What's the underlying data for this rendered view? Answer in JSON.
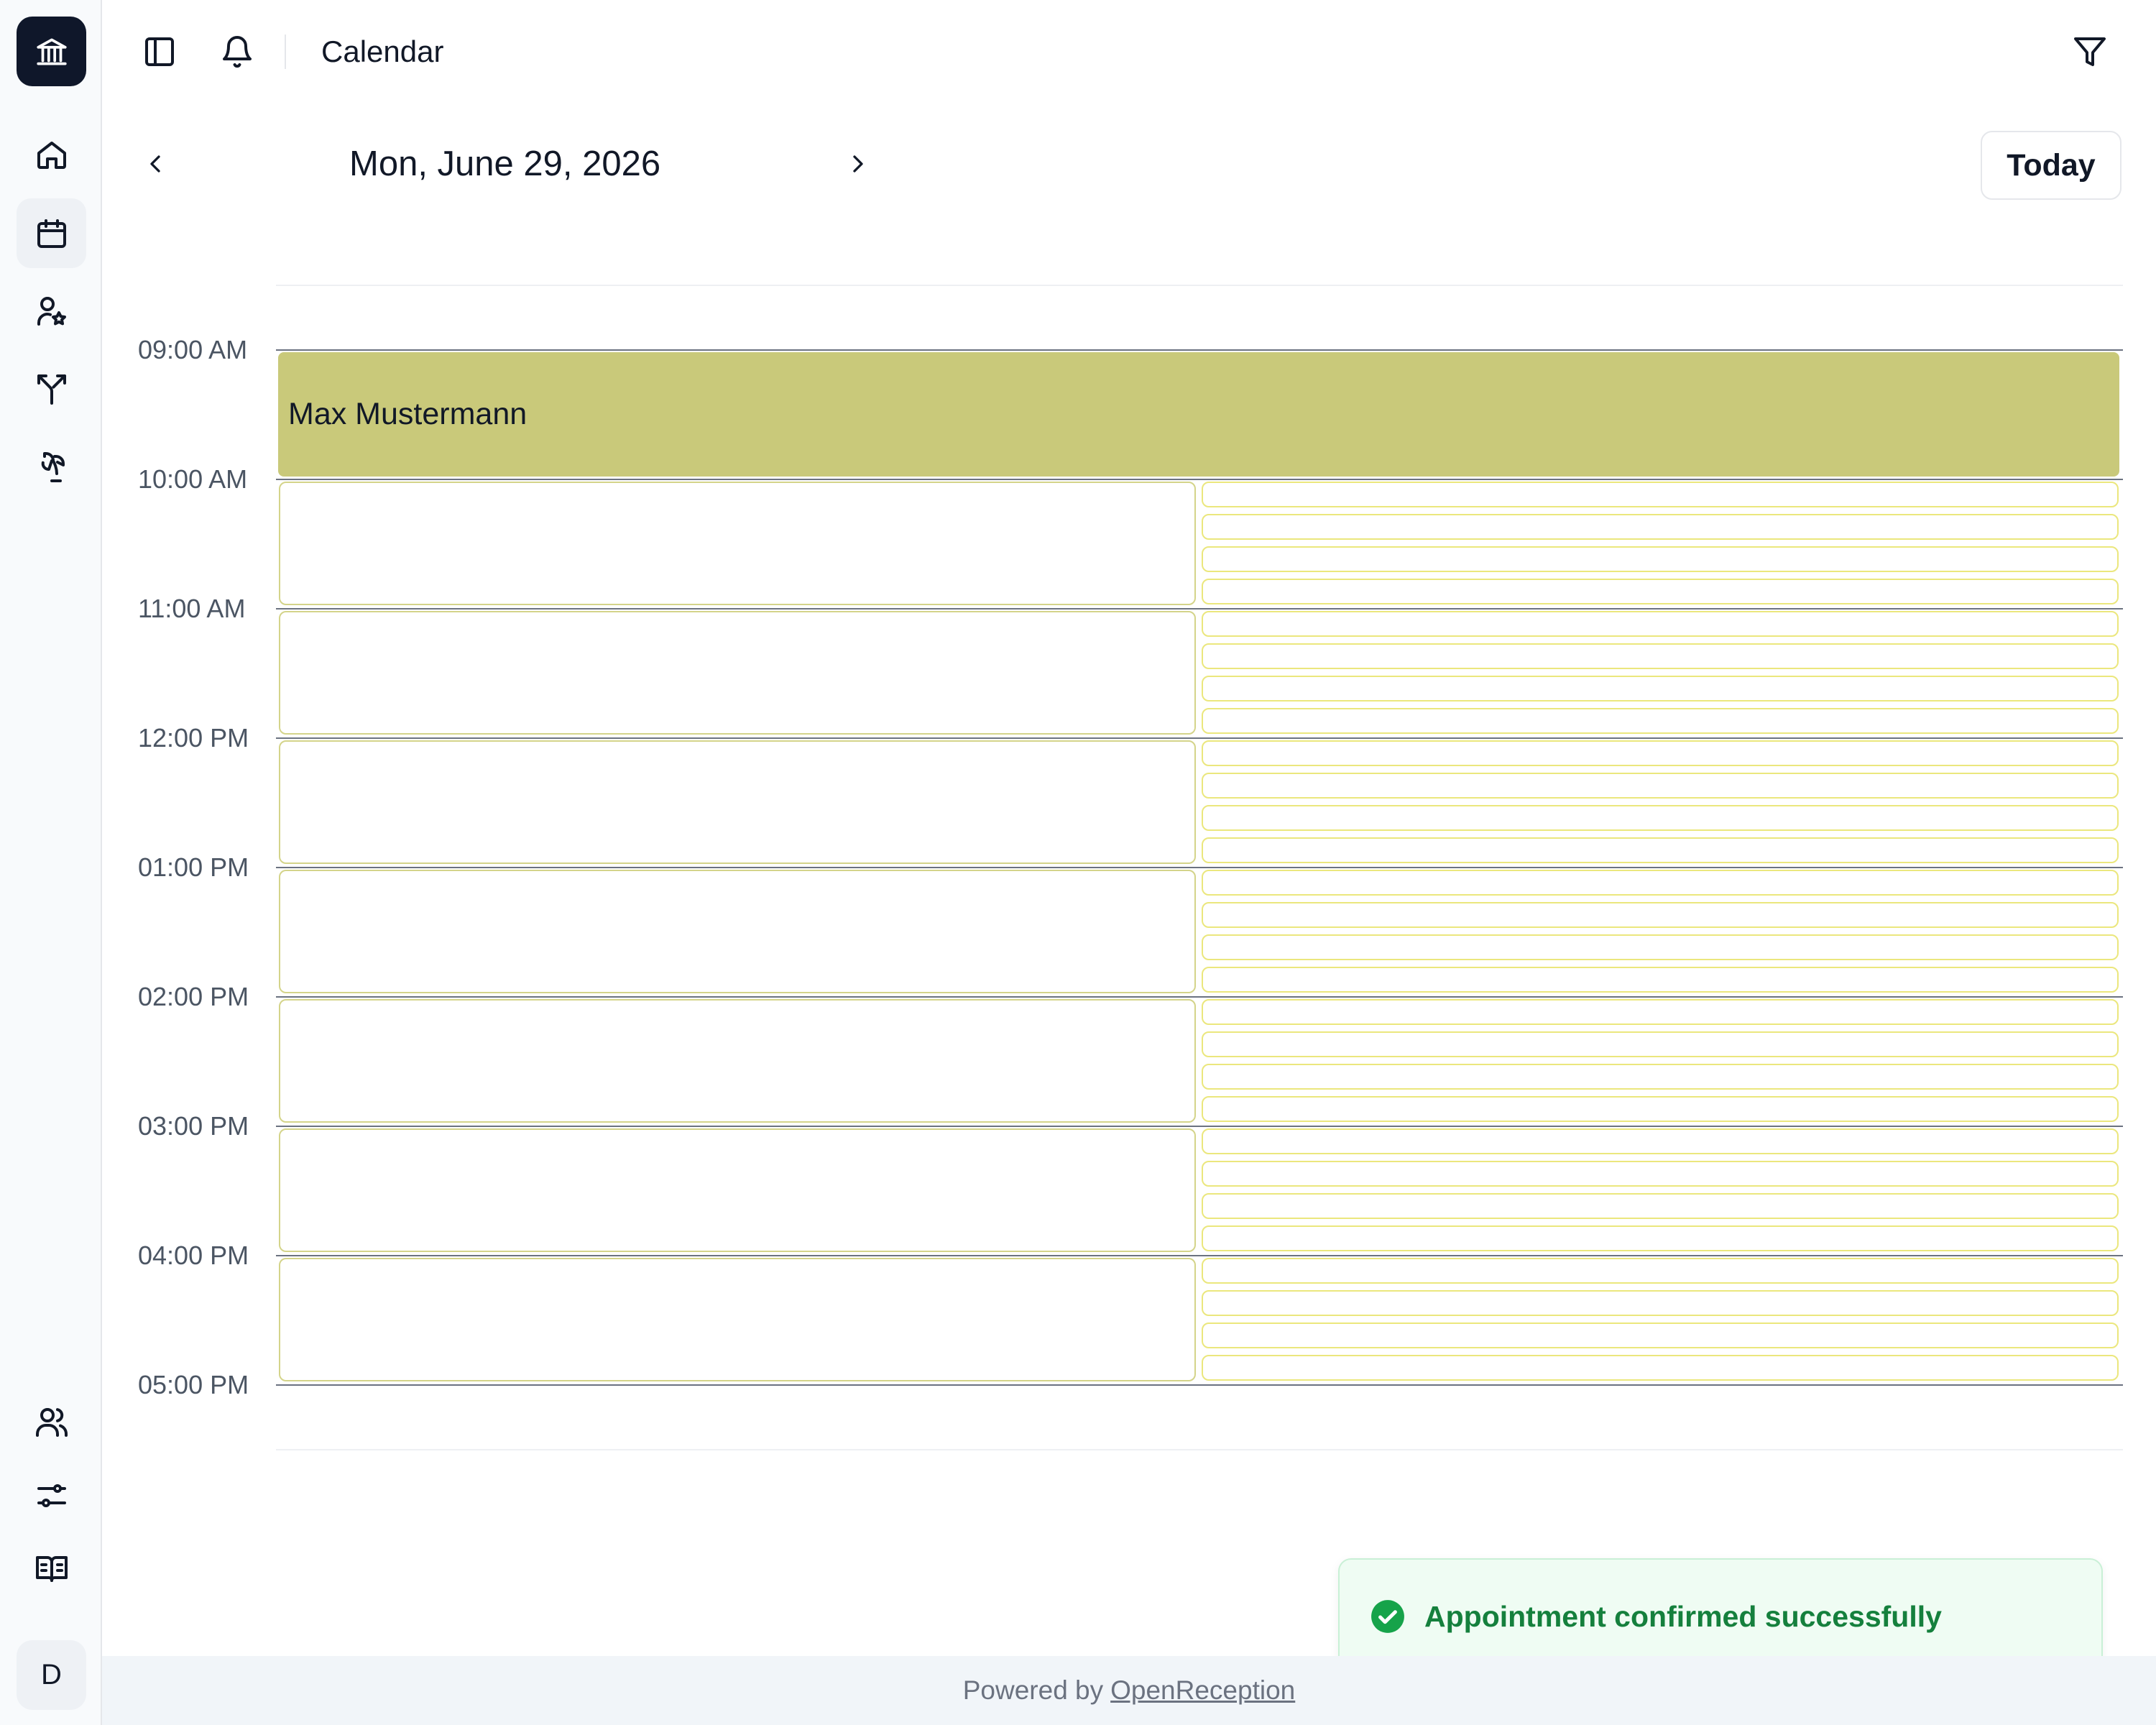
{
  "sidebar": {
    "logo_icon": "bank-icon",
    "nav": [
      {
        "name": "home",
        "icon": "home-icon"
      },
      {
        "name": "calendar",
        "icon": "calendar-icon",
        "active": true
      },
      {
        "name": "clients",
        "icon": "user-star-icon"
      },
      {
        "name": "routing",
        "icon": "split-arrow-icon"
      },
      {
        "name": "vacation",
        "icon": "palm-tree-icon"
      }
    ],
    "bottom_nav": [
      {
        "name": "team",
        "icon": "users-icon"
      },
      {
        "name": "settings",
        "icon": "sliders-icon"
      },
      {
        "name": "docs",
        "icon": "book-open-icon"
      }
    ],
    "avatar_initial": "D"
  },
  "header": {
    "title": "Calendar",
    "filter_icon": "filter-icon"
  },
  "date_nav": {
    "date": "Mon, June 29, 2026",
    "today_label": "Today"
  },
  "calendar": {
    "time_labels": [
      "09:00 AM",
      "10:00 AM",
      "11:00 AM",
      "12:00 PM",
      "01:00 PM",
      "02:00 PM",
      "03:00 PM",
      "04:00 PM",
      "05:00 PM"
    ],
    "event": {
      "name": "Max Mustermann",
      "color": "#c9c97a"
    },
    "slot_border_color": "#ebe77d"
  },
  "toast": {
    "message": "Appointment confirmed successfully",
    "icon": "check-circle-icon",
    "color": "#15803d"
  },
  "footer": {
    "prefix": "Powered by",
    "link": "OpenReception"
  }
}
